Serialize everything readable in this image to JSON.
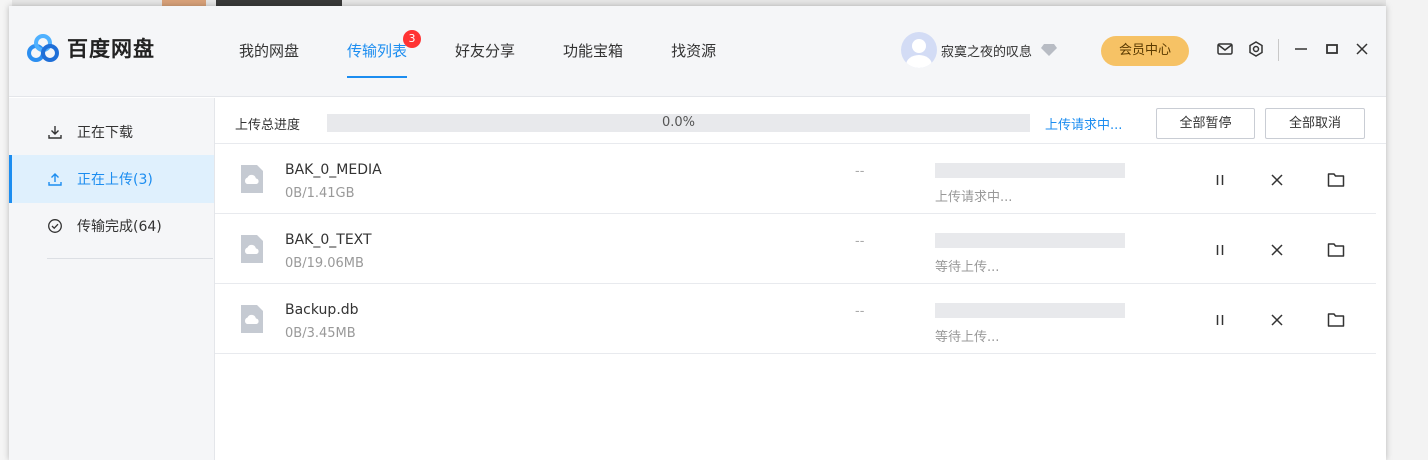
{
  "app": {
    "name": "百度网盘"
  },
  "nav": [
    {
      "label": "我的网盘",
      "active": false
    },
    {
      "label": "传输列表",
      "active": true,
      "badge": "3"
    },
    {
      "label": "好友分享",
      "active": false
    },
    {
      "label": "功能宝箱",
      "active": false
    },
    {
      "label": "找资源",
      "active": false
    }
  ],
  "user": {
    "name": "寂寞之夜的叹息",
    "vip_label": "会员中心"
  },
  "header_icons": [
    "mail-icon",
    "settings-icon",
    "minimize-icon",
    "maximize-icon",
    "close-icon"
  ],
  "sidebar": {
    "items": [
      {
        "label": "正在下载",
        "icon": "download-icon",
        "active": false
      },
      {
        "label": "正在上传(3)",
        "icon": "upload-icon",
        "active": true
      },
      {
        "label": "传输完成(64)",
        "icon": "check-circle-icon",
        "active": false
      }
    ]
  },
  "upload_total": {
    "label": "上传总进度",
    "percent_text": "0.0%",
    "progress": 0.0,
    "status": "上传请求中...",
    "pause_all_label": "全部暂停",
    "cancel_all_label": "全部取消"
  },
  "files": [
    {
      "name": "BAK_0_MEDIA",
      "size": "0B/1.41GB",
      "speed": "--",
      "progress": 0.0,
      "status": "上传请求中..."
    },
    {
      "name": "BAK_0_TEXT",
      "size": "0B/19.06MB",
      "speed": "--",
      "progress": 0.0,
      "status": "等待上传..."
    },
    {
      "name": "Backup.db",
      "size": "0B/3.45MB",
      "speed": "--",
      "progress": 0.0,
      "status": "等待上传..."
    }
  ],
  "colors": {
    "accent": "#1c8df0",
    "badge": "#ff3333",
    "vip": "#f6c265",
    "sidebar_active_bg": "#dff0fd"
  }
}
